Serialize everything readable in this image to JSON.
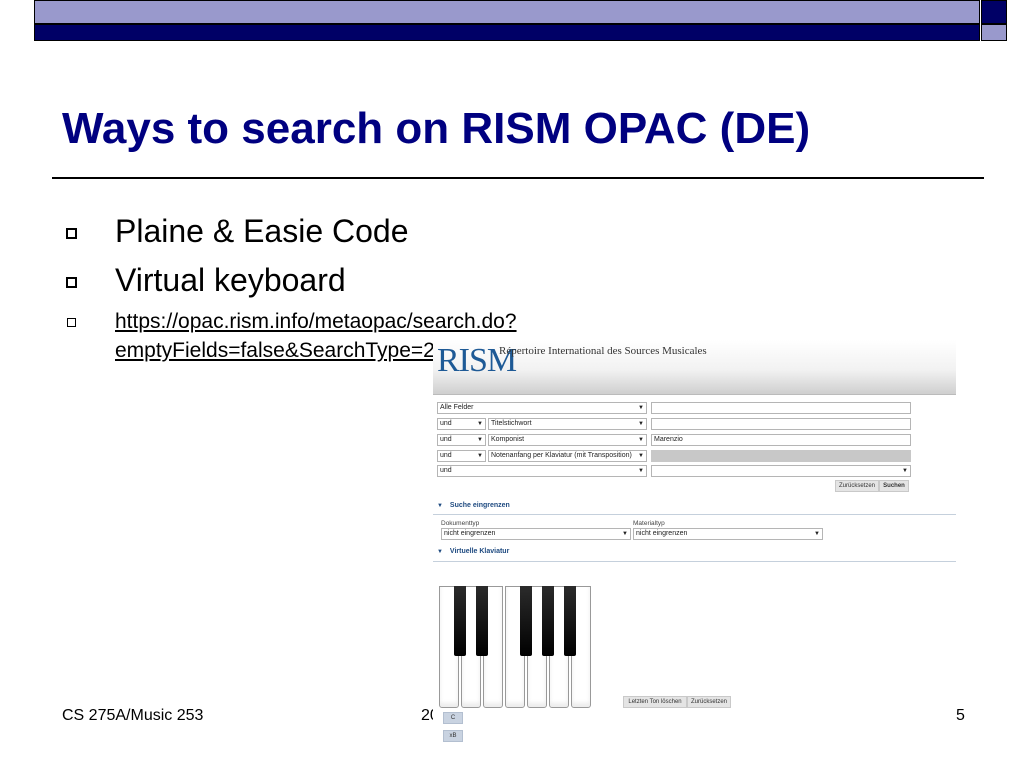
{
  "slide": {
    "title": "Ways to search on RISM OPAC (DE)",
    "bullets": [
      "Plaine & Easie Code",
      "Virtual keyboard"
    ],
    "link": "https://opac.rism.info/metaopac/search.do?emptyFields=false&SearchType=2&methodToCall=switchSearchPage",
    "footer_left": "CS 275A/Music 253",
    "footer_mid": "20",
    "page_number": "5"
  },
  "rism": {
    "logo": "RISM",
    "subtitle": "Répertoire International des Sources Musicales",
    "rows": [
      {
        "operator": "Alle Felder",
        "field": "",
        "value": ""
      },
      {
        "operator": "und",
        "field": "Titelstichwort",
        "value": ""
      },
      {
        "operator": "und",
        "field": "Komponist",
        "value": "Marenzio"
      },
      {
        "operator": "und",
        "field": "Notenanfang per Klaviatur (mit Transposition)",
        "value": ""
      },
      {
        "operator": "und",
        "field": "",
        "value": ""
      }
    ],
    "reset_label": "Zurücksetzen",
    "search_label": "Suchen",
    "section_limit": "Suche eingrenzen",
    "doctype_label": "Dokumenttyp",
    "doctype_value": "nicht eingrenzen",
    "material_label": "Materialtyp",
    "material_value": "nicht eingrenzen",
    "section_keyboard": "Virtuelle Klaviatur",
    "delete_last_label": "Letzten Ton löschen",
    "keyboard_reset_label": "Zurücksetzen",
    "note_c": "C",
    "note_xb": "xB"
  }
}
